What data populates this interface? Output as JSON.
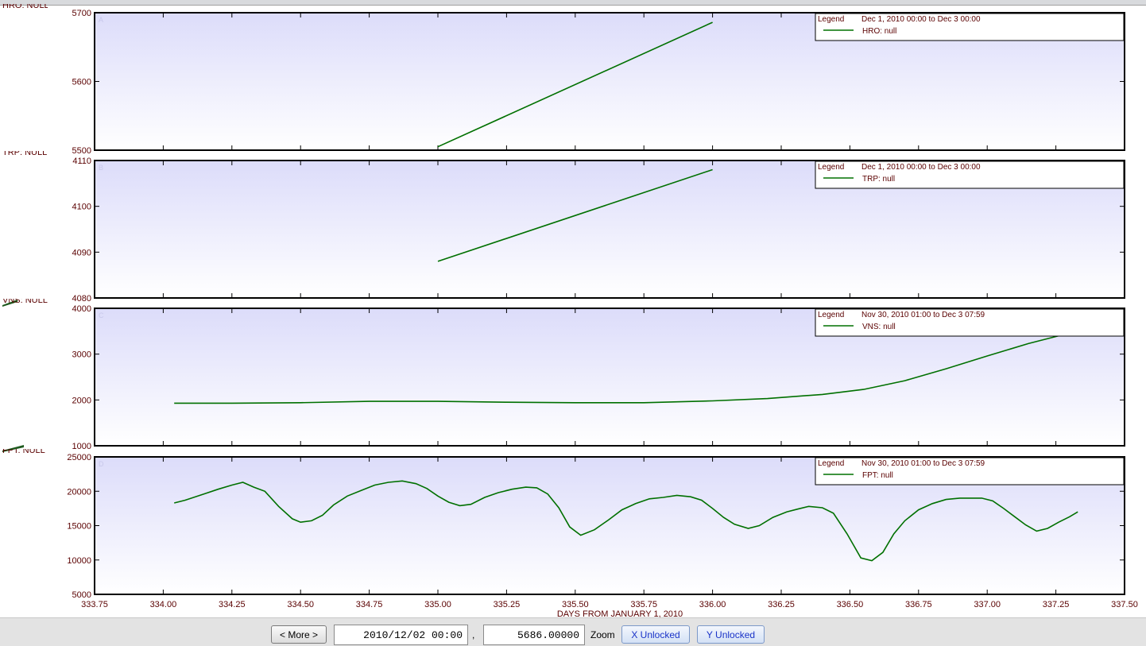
{
  "bottom_bar": {
    "more_button": "< More >",
    "date_value": "2010/12/02 00:00",
    "separator": ",",
    "y_value": "5686.00000",
    "zoom_label": "Zoom",
    "x_lock_button": "X Unlocked",
    "y_lock_button": "Y Unlocked"
  },
  "colors": {
    "series_line": "#007000",
    "plot_gradient_top": "#dcdcfa",
    "plot_gradient_bottom": "#ffffff",
    "tick_label": "#5a0000",
    "lock_button_text": "#1a33c8"
  },
  "chart_data": [
    {
      "type": "line",
      "panel_letter": "A",
      "side_label": "HRO: NULL",
      "legend_title": "Legend",
      "legend_range": "Dec 1, 2010 00:00 to Dec 3 00:00",
      "legend_placement": "top-right",
      "ylim": [
        5500,
        5700
      ],
      "yticks": [
        5500,
        5600,
        5700
      ],
      "series": [
        {
          "name": "HRO: null",
          "x": [
            335.0,
            336.0
          ],
          "y": [
            5505,
            5686
          ]
        }
      ]
    },
    {
      "type": "line",
      "panel_letter": "B",
      "side_label": "TRP: NULL",
      "legend_title": "Legend",
      "legend_range": "Dec 1, 2010 00:00 to Dec 3 00:00",
      "legend_placement": "top-right",
      "ylim": [
        4080,
        4110
      ],
      "yticks": [
        4080,
        4090,
        4100,
        4110
      ],
      "series": [
        {
          "name": "TRP: null",
          "x": [
            335.0,
            336.0
          ],
          "y": [
            4088,
            4108
          ]
        }
      ]
    },
    {
      "type": "line",
      "panel_letter": "C",
      "side_label": "VNS: NULL",
      "legend_title": "Legend",
      "legend_range": "Nov 30, 2010 01:00 to Dec 3 07:59",
      "legend_placement": "top-right",
      "ylim": [
        1000,
        4000
      ],
      "yticks": [
        1000,
        2000,
        3000,
        4000
      ],
      "series": [
        {
          "name": "VNS: null",
          "x": [
            334.04,
            334.25,
            334.5,
            334.75,
            335.0,
            335.25,
            335.5,
            335.75,
            336.0,
            336.2,
            336.4,
            336.55,
            336.7,
            336.85,
            337.0,
            337.15,
            337.28
          ],
          "y": [
            1930,
            1930,
            1940,
            1970,
            1970,
            1950,
            1940,
            1940,
            1980,
            2030,
            2120,
            2230,
            2420,
            2680,
            2960,
            3230,
            3430
          ]
        }
      ]
    },
    {
      "type": "line",
      "panel_letter": "D",
      "side_label": "FPT: NULL",
      "legend_title": "Legend",
      "legend_range": "Nov 30, 2010 01:00 to Dec 3 07:59",
      "legend_placement": "top-right",
      "ylim": [
        5000,
        25000
      ],
      "yticks": [
        5000,
        10000,
        15000,
        20000,
        25000
      ],
      "series": [
        {
          "name": "FPT: null",
          "x": [
            334.04,
            334.08,
            334.14,
            334.2,
            334.25,
            334.29,
            334.33,
            334.37,
            334.42,
            334.47,
            334.5,
            334.54,
            334.58,
            334.62,
            334.67,
            334.72,
            334.77,
            334.82,
            334.87,
            334.92,
            334.96,
            335.0,
            335.04,
            335.08,
            335.12,
            335.17,
            335.22,
            335.27,
            335.32,
            335.36,
            335.4,
            335.44,
            335.48,
            335.52,
            335.57,
            335.62,
            335.67,
            335.72,
            335.77,
            335.82,
            335.87,
            335.92,
            335.96,
            336.0,
            336.04,
            336.08,
            336.13,
            336.17,
            336.22,
            336.27,
            336.31,
            336.35,
            336.4,
            336.44,
            336.49,
            336.54,
            336.58,
            336.62,
            336.66,
            336.7,
            336.75,
            336.8,
            336.85,
            336.9,
            336.94,
            336.98,
            337.02,
            337.06,
            337.1,
            337.14,
            337.18,
            337.22,
            337.26,
            337.3,
            337.33
          ],
          "y": [
            18300,
            18700,
            19500,
            20300,
            20900,
            21300,
            20600,
            20000,
            17800,
            16000,
            15500,
            15700,
            16500,
            18000,
            19300,
            20100,
            20900,
            21300,
            21500,
            21100,
            20400,
            19300,
            18400,
            17900,
            18100,
            19100,
            19800,
            20300,
            20600,
            20500,
            19600,
            17600,
            14800,
            13600,
            14400,
            15800,
            17300,
            18200,
            18900,
            19100,
            19400,
            19200,
            18700,
            17500,
            16200,
            15200,
            14600,
            15000,
            16200,
            17000,
            17400,
            17800,
            17600,
            16800,
            13800,
            10300,
            9900,
            11100,
            13800,
            15700,
            17300,
            18200,
            18800,
            19000,
            19000,
            19000,
            18600,
            17500,
            16300,
            15100,
            14200,
            14600,
            15500,
            16300,
            17000
          ]
        }
      ]
    }
  ],
  "x_axis": {
    "label": "DAYS FROM JANUARY 1, 2010",
    "xlim": [
      333.75,
      337.5
    ],
    "ticks": [
      "333.75",
      "334.00",
      "334.25",
      "334.50",
      "334.75",
      "335.00",
      "335.25",
      "335.50",
      "335.75",
      "336.00",
      "336.25",
      "336.50",
      "336.75",
      "337.00",
      "337.25",
      "337.50"
    ]
  }
}
